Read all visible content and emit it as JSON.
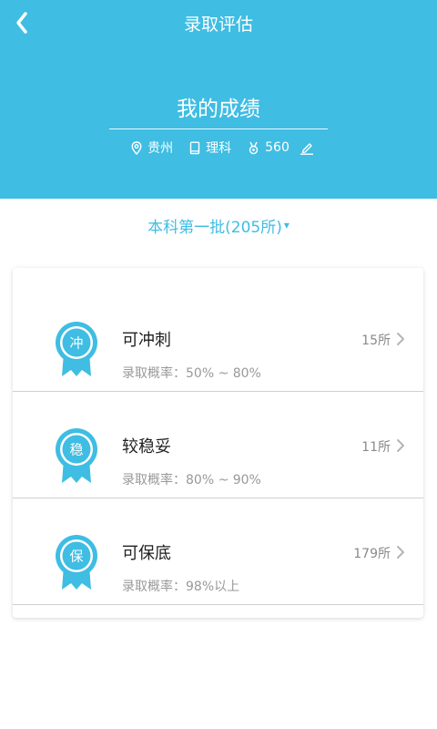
{
  "header": {
    "title": "录取评估",
    "score_title": "我的成绩",
    "province": "贵州",
    "subject": "理科",
    "score": "560"
  },
  "batch": {
    "label": "本科第一批(205所)",
    "arrow": "▾"
  },
  "categories": [
    {
      "medal_char": "冲",
      "title": "可冲刺",
      "count": "15所",
      "probability": "录取概率：50% ~ 80%"
    },
    {
      "medal_char": "稳",
      "title": "较稳妥",
      "count": "11所",
      "probability": "录取概率：80% ~ 90%"
    },
    {
      "medal_char": "保",
      "title": "可保底",
      "count": "179所",
      "probability": "录取概率：98%以上"
    }
  ],
  "colors": {
    "accent": "#3fbde3",
    "text_dark": "#222222",
    "text_muted": "#999999"
  },
  "icons": [
    "back-arrow-icon",
    "location-pin-icon",
    "book-icon",
    "medal-icon",
    "edit-pencil-icon",
    "chevron-right-icon",
    "ribbon-medal-icon"
  ]
}
